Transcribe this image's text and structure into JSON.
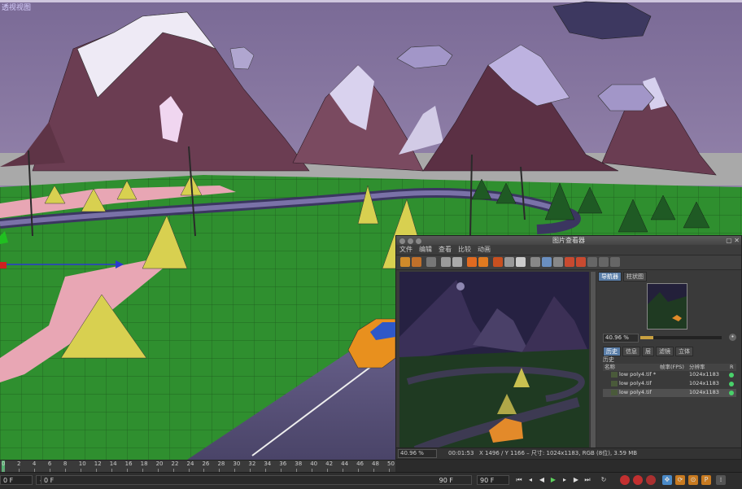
{
  "viewport": {
    "label": "透视视图"
  },
  "viewer": {
    "title": "图片查看器",
    "menu": [
      "文件",
      "编辑",
      "查看",
      "比较",
      "动画"
    ],
    "side_tabs": [
      "导航器",
      "柱状图"
    ],
    "zoom": "40.96 %",
    "info_tabs": [
      "历史",
      "信息",
      "层",
      "滤镜",
      "立体"
    ],
    "history_label": "历史",
    "history_columns": {
      "name": "名称",
      "fps": "帧率(FPS)",
      "res": "分辨率",
      "r": "R"
    },
    "history_rows": [
      {
        "name": "low poly4.tif *",
        "res": "1024x1183"
      },
      {
        "name": "low poly4.tif",
        "res": "1024x1183"
      },
      {
        "name": "low poly4.tif",
        "res": "1024x1183"
      }
    ],
    "status": {
      "zoom": "40.96 %",
      "time": "00:01:53",
      "info": "X 1496 / Y 1166 – 尺寸: 1024x1183, RGB (8位), 3.59 MB"
    }
  },
  "timeline": {
    "ticks": [
      "0",
      "2",
      "4",
      "6",
      "8",
      "10",
      "12",
      "14",
      "16",
      "18",
      "20",
      "22",
      "24",
      "26",
      "28",
      "30",
      "32",
      "34",
      "36",
      "38",
      "40",
      "42",
      "44",
      "46",
      "48",
      "50"
    ],
    "current_frame": "0 F",
    "start_frame": "0 F",
    "end_frame": "90 F",
    "end_frame2": "90 F"
  },
  "colors": {
    "sky": "#8f7aa8",
    "grass": "#2f8f2f",
    "mountain": "#6b3d52",
    "accent": "#5a7ea8",
    "ok_status": "#49d16a"
  }
}
